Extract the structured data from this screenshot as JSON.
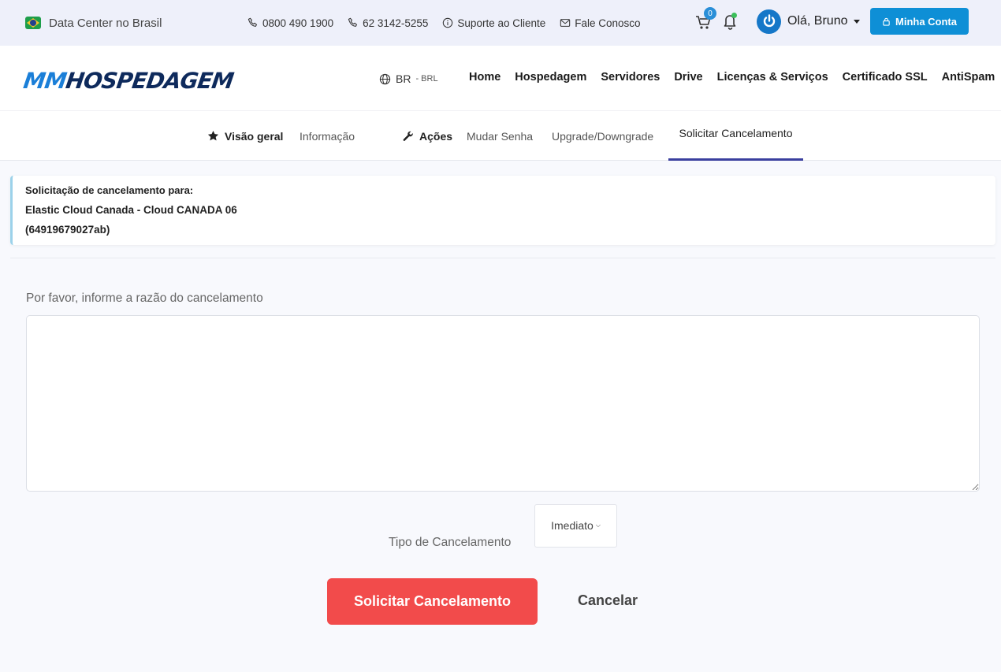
{
  "topbar": {
    "datacenter": "Data Center no Brasil",
    "phone1": "0800 490 1900",
    "phone2": "62 3142-5255",
    "support": "Suporte ao Cliente",
    "contact": "Fale Conosco",
    "cart_count": "0",
    "greeting": "Olá, Bruno",
    "account_button": "Minha Conta"
  },
  "nav": {
    "logo_mm": "MM",
    "logo_rest": "HOSPEDAGEM",
    "lang_main": "BR",
    "lang_sub": "- BRL",
    "items": [
      "Home",
      "Hospedagem",
      "Servidores",
      "Drive",
      "Licenças & Serviços",
      "Certificado SSL",
      "AntiSpam"
    ]
  },
  "subtabs": {
    "overview_heading": "Visão geral",
    "info": "Informação",
    "actions_heading": "Ações",
    "change_password": "Mudar Senha",
    "upgrade": "Upgrade/Downgrade",
    "request_cancel": "Solicitar Cancelamento"
  },
  "infocard": {
    "line1": "Solicitação de cancelamento para:",
    "line2": "Elastic Cloud Canada - Cloud CANADA 06",
    "line3": "(64919679027ab)"
  },
  "form": {
    "reason_label": "Por favor, informe a razão do cancelamento",
    "reason_value": "",
    "type_label": "Tipo de Cancelamento",
    "type_selected": "Imediato",
    "submit_label": "Solicitar Cancelamento",
    "cancel_label": "Cancelar"
  },
  "colors": {
    "accent_blue": "#0e8fd6",
    "danger_red": "#f24b4b",
    "active_tab": "#3a3f9e"
  }
}
